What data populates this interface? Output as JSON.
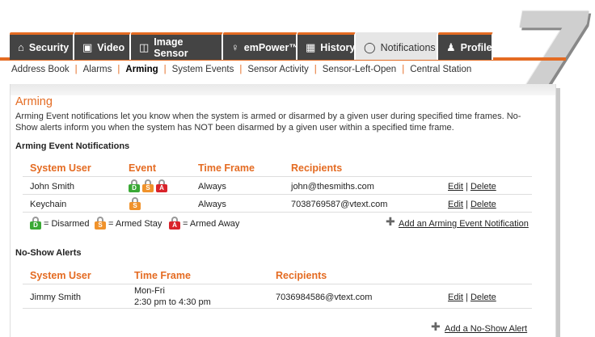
{
  "tabs": [
    {
      "label": "Security",
      "icon": "home-icon",
      "glyph": "⌂"
    },
    {
      "label": "Video",
      "icon": "video-icon",
      "glyph": "▣"
    },
    {
      "label": "Image Sensor",
      "icon": "image-sensor-icon",
      "glyph": "◫"
    },
    {
      "label": "emPower™",
      "icon": "lightbulb-icon",
      "glyph": "♀"
    },
    {
      "label": "History",
      "icon": "calendar-icon",
      "glyph": "▦"
    },
    {
      "label": "Notifications",
      "icon": "speech-bubble-icon",
      "glyph": "◯"
    },
    {
      "label": "Profile",
      "icon": "person-icon",
      "glyph": "♟"
    }
  ],
  "corner_badge": "7",
  "subnav": [
    "Address Book",
    "Alarms",
    "Arming",
    "System Events",
    "Sensor Activity",
    "Sensor-Left-Open",
    "Central Station"
  ],
  "subnav_active": "Arming",
  "page": {
    "title": "Arming",
    "description": "Arming Event notifications let you know when the system is armed or disarmed by a given user during specified time frames. No-Show alerts inform you when the system has NOT been disarmed by a given user within a specified time frame."
  },
  "arming": {
    "section_title": "Arming Event Notifications",
    "headers": {
      "user": "System User",
      "event": "Event",
      "timeframe": "Time Frame",
      "recipients": "Recipients"
    },
    "rows": [
      {
        "user": "John Smith",
        "timeframe": "Always",
        "recipients": "john@thesmiths.com",
        "edit": "Edit",
        "sep": "|",
        "delete": "Delete"
      },
      {
        "user": "Keychain",
        "timeframe": "Always",
        "recipients": "7038769587@vtext.com",
        "edit": "Edit",
        "sep": "|",
        "delete": "Delete"
      }
    ],
    "legend": {
      "disarmed_letter": "D",
      "disarmed": "= Disarmed",
      "stay_letter": "S",
      "stay": "= Armed Stay",
      "away_letter": "A",
      "away": "= Armed Away"
    },
    "add_label": "Add an Arming Event Notification"
  },
  "noshow": {
    "section_title": "No-Show Alerts",
    "headers": {
      "user": "System User",
      "timeframe": "Time Frame",
      "recipients": "Recipients"
    },
    "rows": [
      {
        "user": "Jimmy Smith",
        "timeframe_line1": "Mon-Fri",
        "timeframe_line2": "2:30 pm to 4:30 pm",
        "recipients": "7036984586@vtext.com",
        "edit": "Edit",
        "sep": "|",
        "delete": "Delete"
      }
    ],
    "add_label": "Add a No-Show Alert"
  },
  "colors": {
    "accent": "#e46b22",
    "disarmed": "#3aa935",
    "stay": "#f0922b",
    "away": "#d9232a",
    "tab_dark": "#444444"
  }
}
